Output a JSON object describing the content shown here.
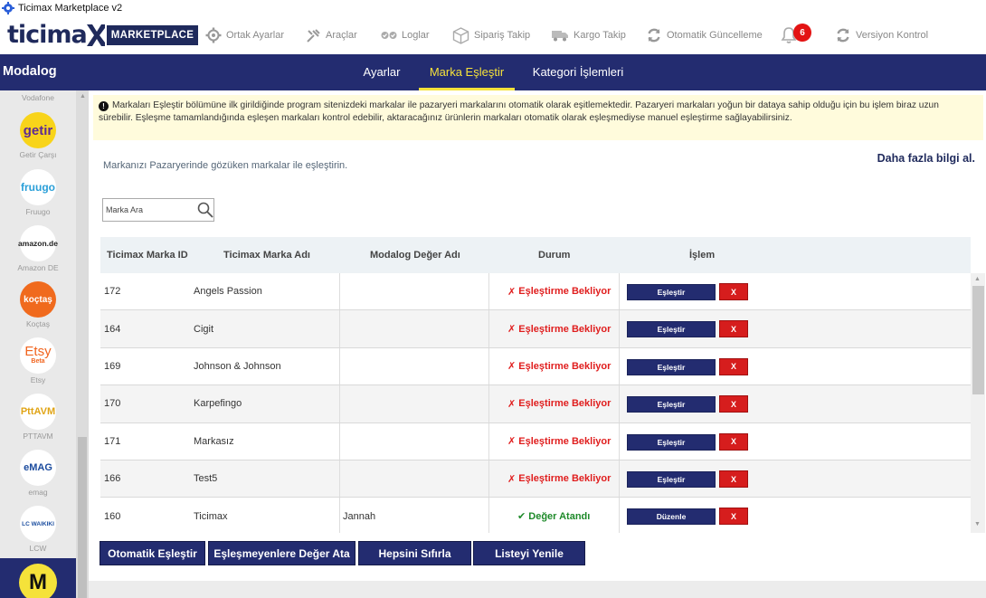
{
  "window": {
    "title": "Ticimax Marketplace v2"
  },
  "logo": {
    "brand": "ticima",
    "badge": "MARKETPLACE"
  },
  "toolbar": {
    "items": [
      {
        "label": "Ortak Ayarlar",
        "icon": "gear-icon"
      },
      {
        "label": "Araçlar",
        "icon": "tools-icon"
      },
      {
        "label": "Loglar",
        "icon": "log-icon"
      },
      {
        "label": "Sipariş Takip",
        "icon": "box-icon"
      },
      {
        "label": "Kargo Takip",
        "icon": "truck-icon"
      },
      {
        "label": "Otomatik Güncelleme",
        "icon": "sync-icon"
      },
      {
        "label": "Versiyon Kontrol",
        "icon": "sync-icon"
      }
    ],
    "notifications": "6"
  },
  "nav": {
    "brand": "Modalog",
    "tabs": [
      {
        "label": "Ayarlar",
        "active": false
      },
      {
        "label": "Marka Eşleştir",
        "active": true
      },
      {
        "label": "Kategori İşlemleri",
        "active": false
      }
    ]
  },
  "sidebar": {
    "items": [
      {
        "name": "Vodafone",
        "logo": ""
      },
      {
        "name": "Getir Çarşı",
        "logo": "getir"
      },
      {
        "name": "Fruugo",
        "logo": "fruugo"
      },
      {
        "name": "Amazon DE",
        "logo": "amazon.de"
      },
      {
        "name": "Koçtaş",
        "logo": "koçtaş"
      },
      {
        "name": "Etsy",
        "logo": "Etsy",
        "tag": "Beta"
      },
      {
        "name": "PTTAVM",
        "logo": "PttAVM"
      },
      {
        "name": "emag",
        "logo": "eMAG"
      },
      {
        "name": "LCW",
        "logo": "LC WAIKIKI"
      }
    ],
    "active_initial": "M"
  },
  "info": {
    "text": "Markaları Eşleştir bölümüne ilk girildiğinde program sitenizdeki markalar ile pazaryeri markalarını otomatik olarak eşitlemektedir. Pazaryeri markaları yoğun bir dataya sahip olduğu için bu işlem biraz uzun sürebilir. Eşleşme tamamlandığında eşleşen markaları kontrol edebilir, aktaracağınız ürünlerin markaları otomatik olarak eşleşmediyse manuel eşleştirme sağlayabilirsiniz."
  },
  "main": {
    "subtitle": "Markanızı Pazaryerinde gözüken markalar ile eşleştirin.",
    "more_info": "Daha fazla bilgi al.",
    "search_placeholder": "Marka Ara"
  },
  "table": {
    "headers": [
      "Ticimax Marka ID",
      "Ticimax Marka Adı",
      "Modalog Değer Adı",
      "Durum",
      "İşlem"
    ],
    "rows": [
      {
        "id": "172",
        "name": "Angels Passion",
        "value": "",
        "status": "Eşleştirme Bekliyor",
        "matched": false,
        "action": "Eşleştir",
        "x": "X"
      },
      {
        "id": "164",
        "name": "Cigit",
        "value": "",
        "status": "Eşleştirme Bekliyor",
        "matched": false,
        "action": "Eşleştir",
        "x": "X"
      },
      {
        "id": "169",
        "name": "Johnson & Johnson",
        "value": "",
        "status": "Eşleştirme Bekliyor",
        "matched": false,
        "action": "Eşleştir",
        "x": "X"
      },
      {
        "id": "170",
        "name": "Karpefingo",
        "value": "",
        "status": "Eşleştirme Bekliyor",
        "matched": false,
        "action": "Eşleştir",
        "x": "X"
      },
      {
        "id": "171",
        "name": "Markasız",
        "value": "",
        "status": "Eşleştirme Bekliyor",
        "matched": false,
        "action": "Eşleştir",
        "x": "X"
      },
      {
        "id": "166",
        "name": "Test5",
        "value": "",
        "status": "Eşleştirme Bekliyor",
        "matched": false,
        "action": "Eşleştir",
        "x": "X"
      },
      {
        "id": "160",
        "name": "Ticimax",
        "value": "Jannah",
        "status": "Değer Atandı",
        "matched": true,
        "action": "Düzenle",
        "x": "X"
      }
    ]
  },
  "actions": {
    "auto_match": "Otomatik Eşleştir",
    "assign_unmatched": "Eşleşmeyenlere Değer Ata",
    "reset_all": "Hepsini Sıfırla",
    "refresh": "Listeyi Yenile"
  },
  "colors": {
    "navy": "#232c70",
    "accent_yellow": "#f5e23a",
    "danger": "#d61d1d",
    "success": "#1e8a2a"
  }
}
